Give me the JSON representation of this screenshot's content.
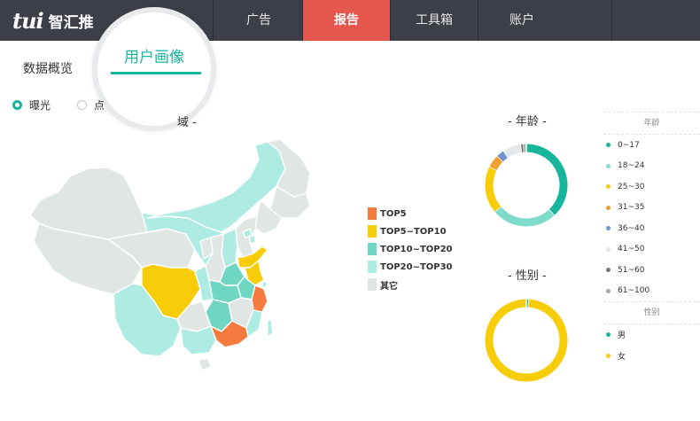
{
  "brand": {
    "logo": "tui",
    "name": "智汇推"
  },
  "nav": {
    "items": [
      {
        "label": "广告",
        "active": false
      },
      {
        "label": "报告",
        "active": true
      },
      {
        "label": "工具箱",
        "active": false
      },
      {
        "label": "账户",
        "active": false
      }
    ],
    "accent_color": "#e5564f",
    "bg_color": "#3c3f47"
  },
  "tabs": {
    "overview": "数据概览",
    "profile": "用户画像"
  },
  "metrics": {
    "exposure": "曝光",
    "click": "点"
  },
  "map_section": {
    "title_fragment": "- 地域 -"
  },
  "map_legend": [
    {
      "label": "TOP5",
      "color": "#f47b3d"
    },
    {
      "label": "TOP5~TOP10",
      "color": "#f7cd0a"
    },
    {
      "label": "TOP10~TOP20",
      "color": "#6fd6c2"
    },
    {
      "label": "TOP20~TOP30",
      "color": "#aeece3"
    },
    {
      "label": "其它",
      "color": "#dfe6e4"
    }
  ],
  "age_chart": {
    "title": "- 年龄 -"
  },
  "gender_chart": {
    "title": "- 性别 -"
  },
  "age_legend": {
    "title": "年龄",
    "items": [
      {
        "label": "0~17",
        "color": "#17b59c"
      },
      {
        "label": "18~24",
        "color": "#7fdccb"
      },
      {
        "label": "25~30",
        "color": "#f7cd0a"
      },
      {
        "label": "31~35",
        "color": "#f0a030"
      },
      {
        "label": "36~40",
        "color": "#7192cf"
      },
      {
        "label": "41~50",
        "color": "#e3e6ea"
      },
      {
        "label": "51~60",
        "color": "#777777"
      },
      {
        "label": "61~100",
        "color": "#a9a9a9"
      }
    ]
  },
  "gender_legend": {
    "title": "性别",
    "items": [
      {
        "label": "男",
        "color": "#17b59c"
      },
      {
        "label": "女",
        "color": "#f7cd0a"
      }
    ]
  },
  "chart_data": [
    {
      "type": "pie",
      "title": "- 年龄 -",
      "categories": [
        "0~17",
        "18~24",
        "25~30",
        "31~35",
        "36~40",
        "41~50",
        "51~60",
        "61~100"
      ],
      "values": [
        37,
        25,
        18,
        5,
        3,
        7,
        1,
        1
      ]
    },
    {
      "type": "pie",
      "title": "- 性别 -",
      "categories": [
        "男",
        "女"
      ],
      "values": [
        1,
        99
      ]
    }
  ]
}
